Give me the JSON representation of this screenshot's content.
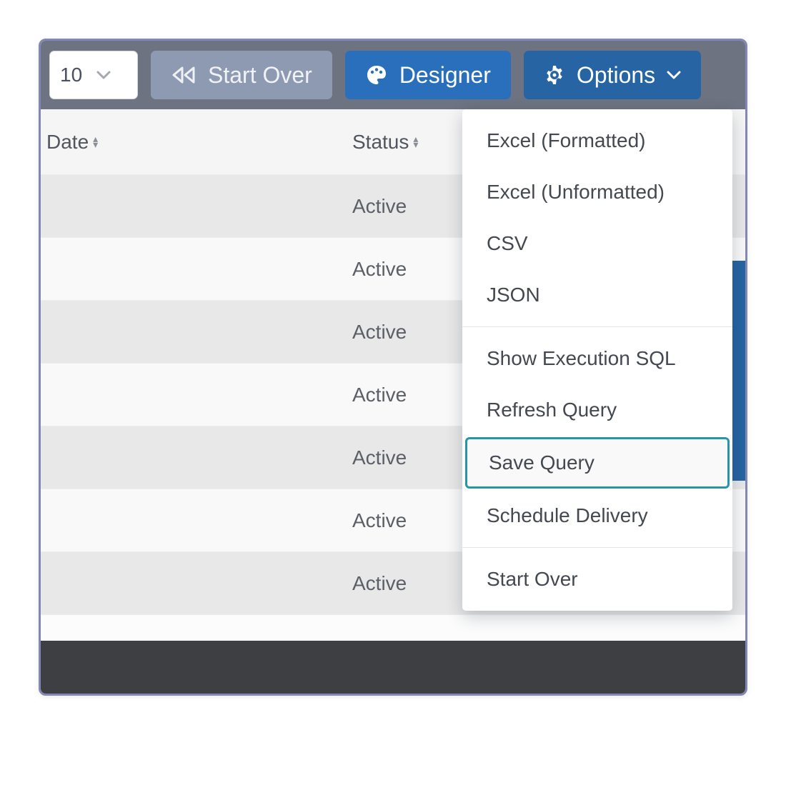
{
  "toolbar": {
    "page_size_value": "10",
    "start_over_label": "Start Over",
    "designer_label": "Designer",
    "options_label": "Options"
  },
  "table": {
    "headers": {
      "date": "Date",
      "status": "Status"
    },
    "rows": [
      {
        "date": "",
        "status": "Active"
      },
      {
        "date": "",
        "status": "Active"
      },
      {
        "date": "",
        "status": "Active"
      },
      {
        "date": "",
        "status": "Active"
      },
      {
        "date": "",
        "status": "Active"
      },
      {
        "date": "",
        "status": "Active"
      },
      {
        "date": "",
        "status": "Active"
      }
    ]
  },
  "options_menu": {
    "group1": [
      "Excel (Formatted)",
      "Excel (Unformatted)",
      "CSV",
      "JSON"
    ],
    "group2": [
      "Show Execution SQL",
      "Refresh Query",
      "Save Query",
      "Schedule Delivery"
    ],
    "group3": [
      "Start Over"
    ],
    "highlighted": "Save Query"
  },
  "icons": {
    "rewind": "rewind-icon",
    "palette": "palette-icon",
    "gear": "gear-icon",
    "chevron_down": "chevron-down-icon",
    "caret_down": "caret-down-icon",
    "sort": "sort-icon"
  }
}
